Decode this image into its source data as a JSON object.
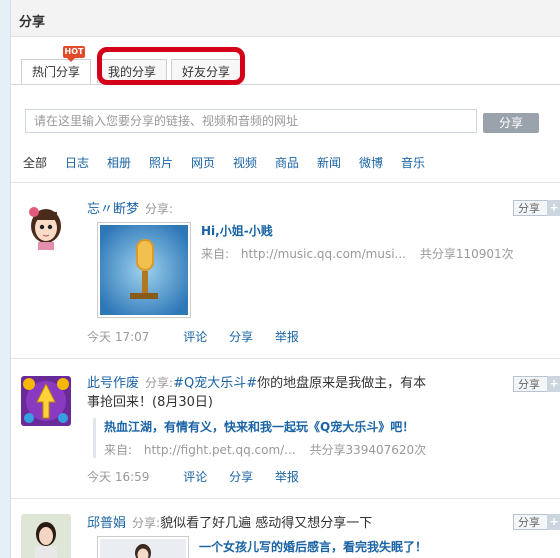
{
  "page_title": "分享",
  "tabs": [
    "热门分享",
    "我的分享",
    "好友分享"
  ],
  "hot_badge": "HOT",
  "share_input": {
    "placeholder": "请在这里输入您要分享的链接、视频和音频的网址"
  },
  "share_button": "分享",
  "categories": [
    "全部",
    "日志",
    "相册",
    "照片",
    "网页",
    "视频",
    "商品",
    "新闻",
    "微博",
    "音乐"
  ],
  "share_small_label": "分享",
  "feed": [
    {
      "name": "忘〃断梦",
      "share_word": "分享:",
      "content": "",
      "quote_title": "Hi,小姐-小贱",
      "source_label": "来自:",
      "source_url": "http://music.qq.com/musi...",
      "share_count": "共分享110901次",
      "time": "今天 17:07",
      "actions": [
        "评论",
        "分享",
        "举报"
      ]
    },
    {
      "name": "此号作废",
      "share_word": "分享:",
      "content_tag": "#Q宠大乐斗#",
      "content": "你的地盘原来是我做主，有本",
      "content_line2": "事抢回来！(8月30日)",
      "quote_title": "热血江湖，有情有义，快来和我一起玩《Q宠大乐斗》吧！",
      "source_label": "来自:",
      "source_url": "http://fight.pet.qq.com/...",
      "share_count": "共分享339407620次",
      "time": "今天 16:59",
      "actions": [
        "评论",
        "分享",
        "举报"
      ]
    },
    {
      "name": "邱普娟",
      "share_word": "分享:",
      "content": "貌似看了好几遍 感动得又想分享一下",
      "quote_title": "一个女孩儿写的婚后感言，看完我失眠了！"
    }
  ]
}
